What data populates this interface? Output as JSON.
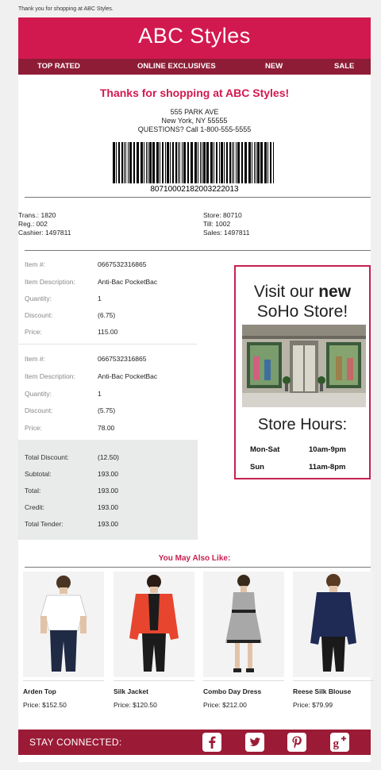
{
  "preheader": "Thank you for shopping at ABC Styles.",
  "brand": "ABC Styles",
  "nav": [
    "TOP RATED",
    "ONLINE EXCLUSIVES",
    "NEW",
    "SALE"
  ],
  "thanks": "Thanks for shopping at ABC Styles!",
  "address": {
    "street": "555 PARK AVE",
    "city": "New York, NY 55555",
    "questions": "QUESTIONS? Call 1-800-555-5555"
  },
  "barcode_number": "80710002182003222013",
  "transaction": {
    "trans": "Trans.: 1820",
    "reg": "Reg.: 002",
    "cashier": "Cashier: 1497811",
    "store": "Store: 80710",
    "till": "Till: 1002",
    "sales": "Sales: 1497811"
  },
  "labels": {
    "item_no": "Item #:",
    "description": "Item Description:",
    "quantity": "Quantity:",
    "discount": "Discount:",
    "price": "Price:"
  },
  "items": [
    {
      "item_no": "0667532316865",
      "description": "Anti-Bac PocketBac",
      "quantity": "1",
      "discount": "(6.75)",
      "price": "115.00"
    },
    {
      "item_no": "0667532316865",
      "description": "Anti-Bac PocketBac",
      "quantity": "1",
      "discount": "(5.75)",
      "price": "78.00"
    }
  ],
  "totals": [
    {
      "label": "Total Discount:",
      "value": "(12.50)"
    },
    {
      "label": "Subtotal:",
      "value": "193.00"
    },
    {
      "label": "Total:",
      "value": "193.00"
    },
    {
      "label": "Credit:",
      "value": "193.00"
    },
    {
      "label": "Total Tender:",
      "value": "193.00"
    }
  ],
  "promo": {
    "line1": "Visit our ",
    "line1_bold": "new",
    "line2": "SoHo Store!",
    "hours_title": "Store Hours:",
    "hours": [
      {
        "day": "Mon-Sat",
        "time": "10am-9pm"
      },
      {
        "day": "Sun",
        "time": "11am-8pm"
      }
    ]
  },
  "recommend_title": "You May Also Like:",
  "products": [
    {
      "name": "Arden Top",
      "price": "Price: $152.50"
    },
    {
      "name": "Silk Jacket",
      "price": "Price: $120.50"
    },
    {
      "name": "Combo Day Dress",
      "price": "Price: $212.00"
    },
    {
      "name": "Reese Silk Blouse",
      "price": "Price: $79.99"
    }
  ],
  "footer": {
    "stay_connected": "STAY CONNECTED:",
    "social_icons": [
      "facebook-icon",
      "twitter-icon",
      "pinterest-icon",
      "google-plus-icon"
    ]
  },
  "colors": {
    "brand_pink": "#d2194f",
    "nav_maroon": "#8f1c36",
    "footer_maroon": "#9b1b36",
    "promo_border": "#c62051",
    "totals_bg": "#e9eaea"
  }
}
